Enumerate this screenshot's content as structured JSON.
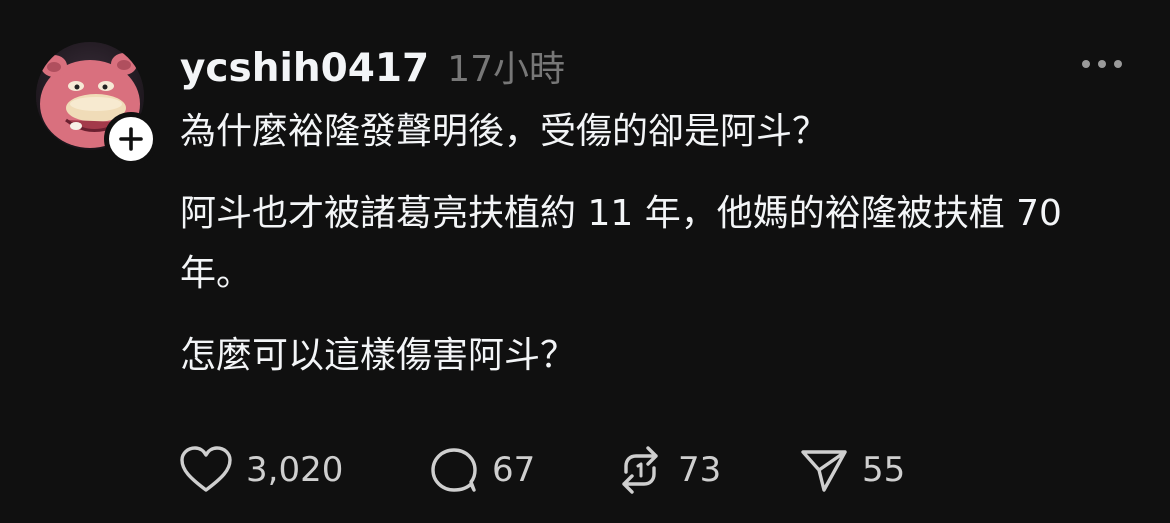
{
  "post": {
    "username": "ycshih0417",
    "timestamp": "17小時",
    "more_icon": "ellipsis-icon",
    "follow_icon": "plus-icon",
    "avatar_icon": "pink-cartoon-avatar",
    "paragraphs": [
      "為什麼裕隆發聲明後，受傷的卻是阿斗？",
      "阿斗也才被諸葛亮扶植約 11 年，他媽的裕隆被扶植 70 年。",
      "怎麼可以這樣傷害阿斗？"
    ]
  },
  "actions": {
    "like": {
      "icon": "heart-icon",
      "count": "3,020"
    },
    "comment": {
      "icon": "comment-bubble-icon",
      "count": "67"
    },
    "repost": {
      "icon": "repost-icon",
      "count": "73"
    },
    "share": {
      "icon": "send-icon",
      "count": "55"
    }
  },
  "colors": {
    "background": "#101010",
    "primary_text": "#f3f5f7",
    "secondary_text": "#777777",
    "action_text": "#cfcfcf",
    "avatar_pink": "#d9707e"
  }
}
